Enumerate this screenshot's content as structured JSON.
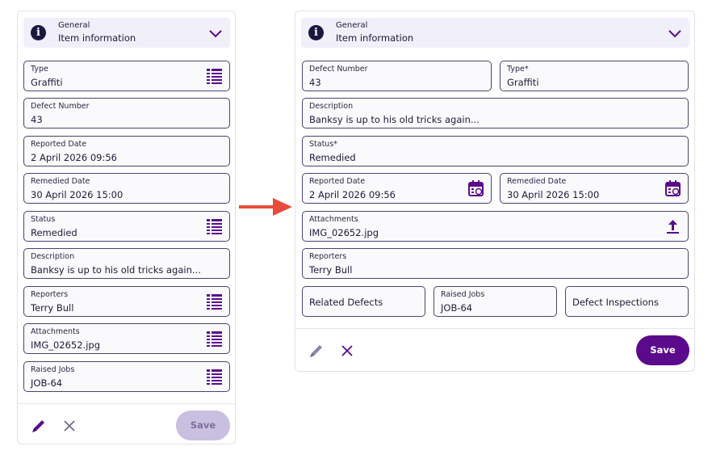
{
  "colors": {
    "accent": "#5b0a8c",
    "arrow": "#e74c3c",
    "border": "#4a4570"
  },
  "before": {
    "header": {
      "subtitle": "General",
      "title": "Item information",
      "icon": "info-icon"
    },
    "fields": {
      "type": {
        "label": "Type",
        "value": "Graffiti"
      },
      "defect_number": {
        "label": "Defect Number",
        "value": "43"
      },
      "reported_date": {
        "label": "Reported Date",
        "value": "2 April 2026 09:56"
      },
      "remedied_date": {
        "label": "Remedied Date",
        "value": "30 April 2026 15:00"
      },
      "status": {
        "label": "Status",
        "value": "Remedied"
      },
      "description": {
        "label": "Description",
        "value": "Banksy is up to his old tricks again..."
      },
      "reporters": {
        "label": "Reporters",
        "value": "Terry Bull"
      },
      "attachments": {
        "label": "Attachments",
        "value": "IMG_02652.jpg"
      },
      "raised_jobs": {
        "label": "Raised Jobs",
        "value": "JOB-64"
      }
    },
    "footer": {
      "save_label": "Save"
    }
  },
  "after": {
    "header": {
      "subtitle": "General",
      "title": "Item information",
      "icon": "info-icon"
    },
    "fields": {
      "defect_number": {
        "label": "Defect Number",
        "value": "43"
      },
      "type": {
        "label": "Type*",
        "value": "Graffiti"
      },
      "description": {
        "label": "Description",
        "value": "Banksy is up to his old tricks again..."
      },
      "status": {
        "label": "Status*",
        "value": "Remedied"
      },
      "reported_date": {
        "label": "Reported Date",
        "value": "2 April 2026 09:56"
      },
      "remedied_date": {
        "label": "Remedied Date",
        "value": "30 April 2026 15:00"
      },
      "attachments": {
        "label": "Attachments",
        "value": "IMG_02652.jpg"
      },
      "reporters": {
        "label": "Reporters",
        "value": "Terry Bull"
      },
      "raised_jobs": {
        "label": "Raised Jobs",
        "value": "JOB-64"
      }
    },
    "links": {
      "related_defects": "Related Defects",
      "defect_inspections": "Defect Inspections"
    },
    "footer": {
      "save_label": "Save"
    }
  }
}
